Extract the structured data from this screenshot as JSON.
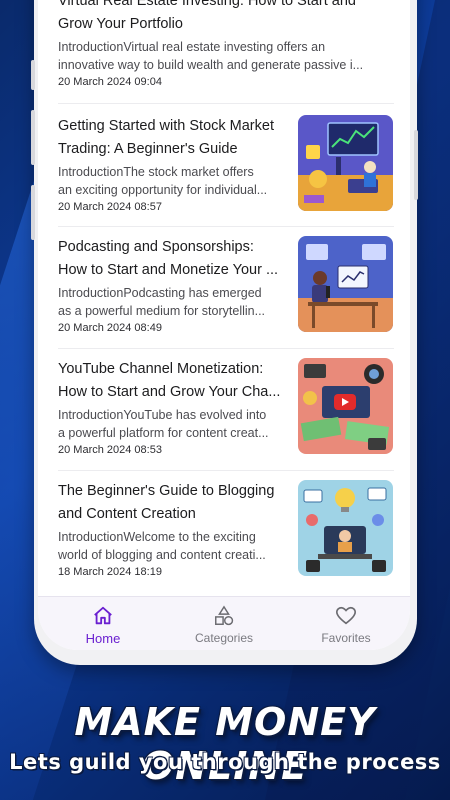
{
  "articles": [
    {
      "title_lines": [
        "Virtual Real Estate Investing: How to Start and",
        "Grow Your Portfolio"
      ],
      "excerpt_lines": [
        "IntroductionVirtual real estate investing offers an",
        "innovative way to build wealth and generate passive i..."
      ],
      "date": "20 March 2024 09:04",
      "has_thumbnail": false
    },
    {
      "title_lines": [
        "Getting Started with Stock Market",
        "Trading: A Beginner's Guide"
      ],
      "excerpt_lines": [
        "IntroductionThe stock market offers",
        "an exciting opportunity for individual..."
      ],
      "date": "20 March 2024 08:57",
      "has_thumbnail": true,
      "thumbnail": "stock-trading-illustration"
    },
    {
      "title_lines": [
        "Podcasting and Sponsorships:",
        "How to Start and Monetize Your ..."
      ],
      "excerpt_lines": [
        "IntroductionPodcasting has emerged",
        "as a powerful medium for storytellin..."
      ],
      "date": "20 March 2024 08:49",
      "has_thumbnail": true,
      "thumbnail": "podcast-studio-illustration"
    },
    {
      "title_lines": [
        "YouTube Channel Monetization:",
        "How to Start and Grow Your Cha..."
      ],
      "excerpt_lines": [
        "IntroductionYouTube has evolved into",
        "a powerful platform for content creat..."
      ],
      "date": "20 March 2024 08:53",
      "has_thumbnail": true,
      "thumbnail": "youtube-money-illustration"
    },
    {
      "title_lines": [
        "The Beginner's Guide to Blogging",
        "and Content Creation"
      ],
      "excerpt_lines": [
        "IntroductionWelcome to the exciting",
        "world of blogging and content creati..."
      ],
      "date": "18 March 2024 18:19",
      "has_thumbnail": true,
      "thumbnail": "blogging-illustration"
    }
  ],
  "nav": {
    "home": {
      "label": "Home",
      "icon": "home-icon",
      "active": true
    },
    "categories": {
      "label": "Categories",
      "icon": "categories-shapes-icon"
    },
    "favorites": {
      "label": "Favorites",
      "icon": "heart-icon"
    }
  },
  "promo": {
    "headline": "MAKE MONEY ONLINE",
    "subline": "Lets guild you through the process"
  },
  "colors": {
    "accent": "#6a1fd0",
    "background": "#0d3d9e",
    "text": "#1c1c1e"
  }
}
